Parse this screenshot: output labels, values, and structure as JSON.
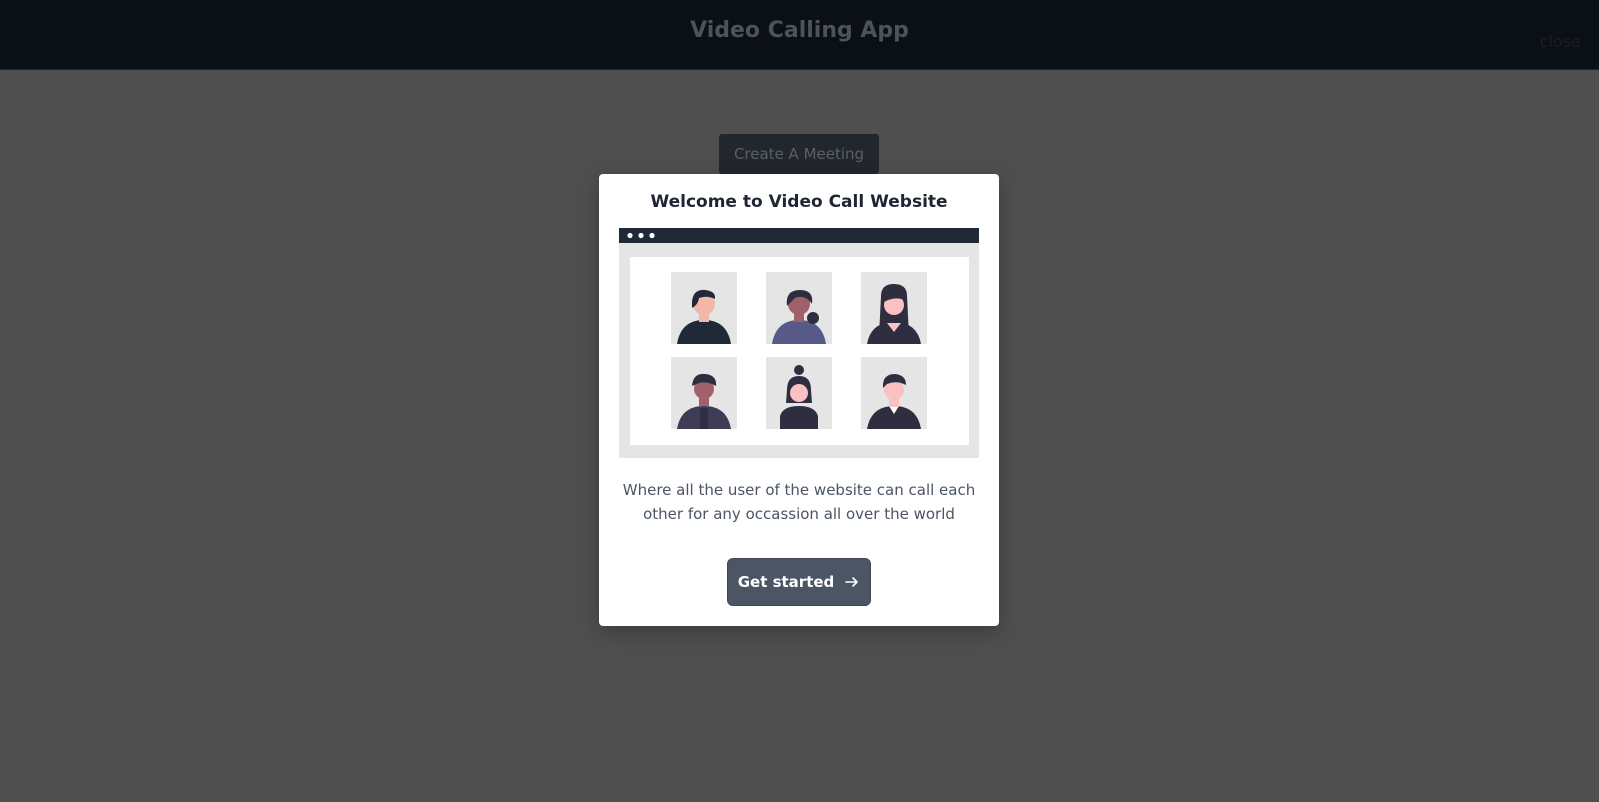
{
  "header": {
    "app_title": "Video Calling App",
    "close_label": "close"
  },
  "main": {
    "create_meeting_label": "Create A Meeting"
  },
  "modal": {
    "title": "Welcome to Video Call Website",
    "description": "Where all the user of the website can call each other for any occassion all over the world",
    "cta_label": "Get started",
    "cta_icon": "arrow-right-icon",
    "illustration": "video-call-grid-illustration"
  },
  "colors": {
    "topbar_bg": "#0b0f16",
    "page_bg": "#4f4f4f",
    "modal_bg": "#ffffff",
    "cta_bg": "#4b5563",
    "illustration_frame": "#1f2937"
  }
}
